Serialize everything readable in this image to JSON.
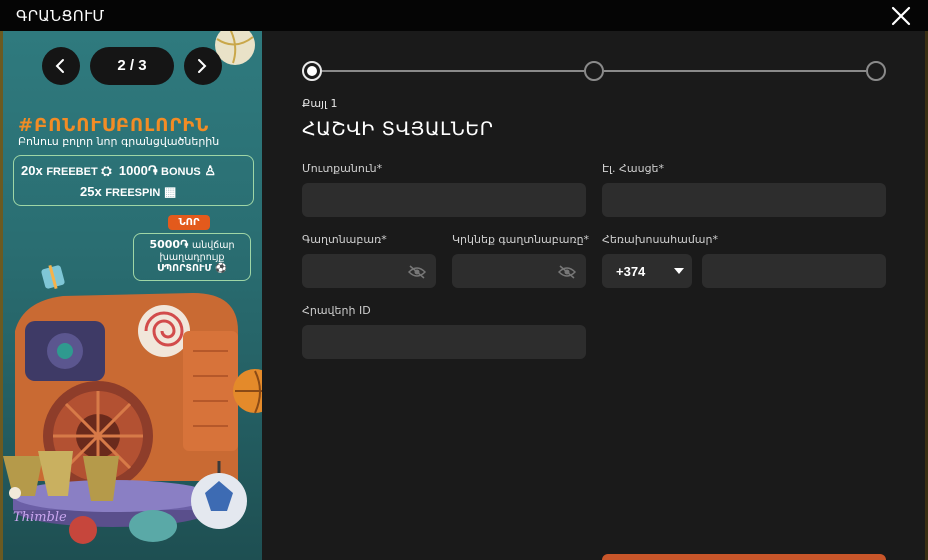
{
  "window": {
    "title": "ԳՐԱՆՑՈՒՄ",
    "close_icon": "close-icon"
  },
  "promo": {
    "pager": {
      "current": "2 / 3",
      "prev_icon": "chevron-left-icon",
      "next_icon": "chevron-right-icon"
    },
    "hashtag": "#ԲՈՆՈՒՍԲՈԼՈՐԻՆ",
    "subtitle": "Բոնուս բոլոր նոր գրանցվածներին",
    "offer": {
      "freebet_count": "20x",
      "freebet_label": "FREEBET",
      "bonus_amount": "1000֏",
      "bonus_label": "BONUS",
      "freespin_count": "25x",
      "freespin_label": "FREESPIN"
    },
    "badge_new": "ՆՈՐ",
    "sport_offer": {
      "amount": "5000֏",
      "free_word": "անվճար",
      "bet_word": "խաղադրույք",
      "sport_word": "ՍՊՈՐՏՈՒՄ"
    },
    "colors": {
      "accent_orange": "#f28c25",
      "teal_bg": "#2f7a7e"
    }
  },
  "form": {
    "steps": {
      "total": 3,
      "current": 1
    },
    "step_label": "Քայլ 1",
    "section_title": "ՀԱՇՎԻ ՏՎՅԱԼՆԵՐ",
    "fields": {
      "username": {
        "label": "Մուտքանուն*",
        "value": "",
        "placeholder": ""
      },
      "email": {
        "label": "Էլ. Հասցե*",
        "value": "",
        "placeholder": ""
      },
      "password": {
        "label": "Գաղտնաբառ*",
        "value": "",
        "placeholder": ""
      },
      "password_repeat": {
        "label": "Կրկնեք գաղտնաբառը*",
        "value": "",
        "placeholder": ""
      },
      "phone": {
        "label": "Հեռախոսահամար*",
        "code": "+374",
        "value": "",
        "placeholder": ""
      },
      "promo_id": {
        "label": "Հրավերի ID",
        "value": "",
        "placeholder": ""
      }
    },
    "colors": {
      "field_bg": "#2d2d2d",
      "panel_bg": "#1a1a1a",
      "button_orange": "#c9562a"
    }
  }
}
